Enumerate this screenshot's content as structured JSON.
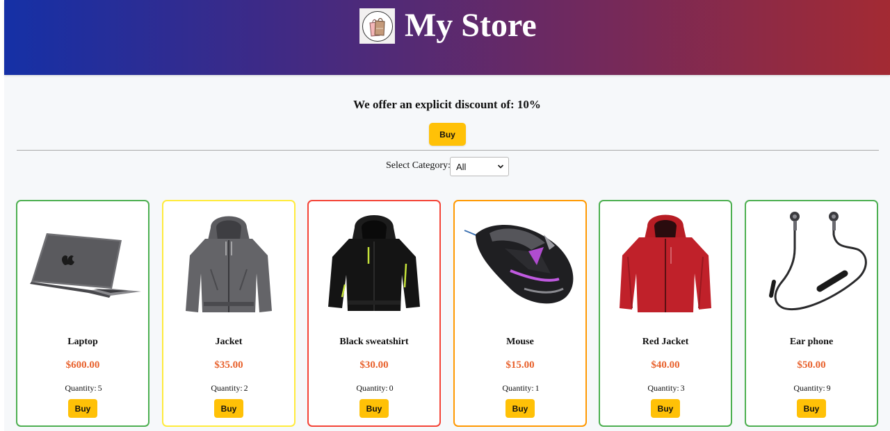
{
  "header": {
    "title": "My Store",
    "logo_icon": "shopping-bags-icon"
  },
  "promo": {
    "discount_text": "We offer an explicit discount of: 10%",
    "buy_label": "Buy"
  },
  "filter": {
    "label": "Select Category:",
    "selected": "All"
  },
  "colors": {
    "header_gradient": [
      "#1530a6",
      "#70295e",
      "#a32a33"
    ],
    "button": "#ffc107",
    "price": "#e8612c"
  },
  "products": [
    {
      "name": "Laptop",
      "price": "$600.00",
      "quantity_label": "Quantity:",
      "quantity": "5",
      "buy_label": "Buy",
      "border_color": "#4caf50",
      "image_icon": "laptop-icon"
    },
    {
      "name": "Jacket",
      "price": "$35.00",
      "quantity_label": "Quantity:",
      "quantity": "2",
      "buy_label": "Buy",
      "border_color": "#ffeb3b",
      "image_icon": "gray-hoodie-icon"
    },
    {
      "name": "Black sweatshirt",
      "price": "$30.00",
      "quantity_label": "Quantity:",
      "quantity": "0",
      "buy_label": "Buy",
      "border_color": "#f44336",
      "image_icon": "black-hoodie-icon"
    },
    {
      "name": "Mouse",
      "price": "$15.00",
      "quantity_label": "Quantity:",
      "quantity": "1",
      "buy_label": "Buy",
      "border_color": "#ff9800",
      "image_icon": "gaming-mouse-icon"
    },
    {
      "name": "Red Jacket",
      "price": "$40.00",
      "quantity_label": "Quantity:",
      "quantity": "3",
      "buy_label": "Buy",
      "border_color": "#4caf50",
      "image_icon": "red-jacket-icon"
    },
    {
      "name": "Ear phone",
      "price": "$50.00",
      "quantity_label": "Quantity:",
      "quantity": "9",
      "buy_label": "Buy",
      "border_color": "#4caf50",
      "image_icon": "earphones-icon"
    }
  ]
}
